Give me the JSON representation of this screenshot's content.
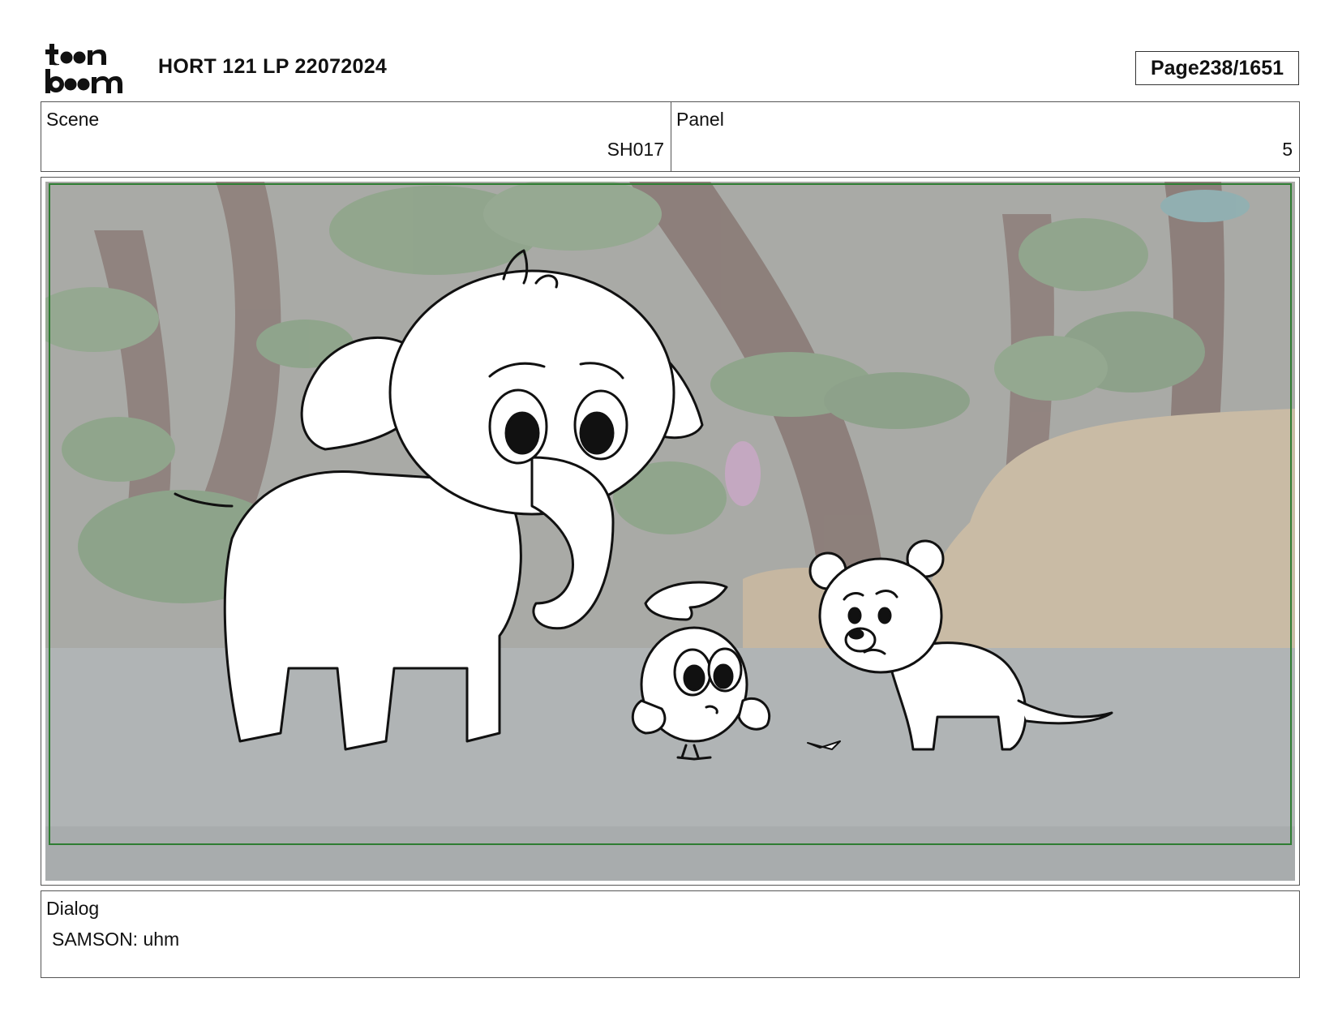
{
  "header": {
    "logo_text": "toon boom",
    "doc_title": "HORT 121 LP 22072024",
    "page_prefix": "Page",
    "page_number": "238/1651"
  },
  "scene": {
    "label": "Scene",
    "value": "SH017"
  },
  "panel": {
    "label": "Panel",
    "value": "5"
  },
  "artwork": {
    "description_icon": "storyboard-frame-image",
    "safe_frame_color": "#2e7d32"
  },
  "dialog": {
    "label": "Dialog",
    "text": "SAMSON: uhm"
  }
}
